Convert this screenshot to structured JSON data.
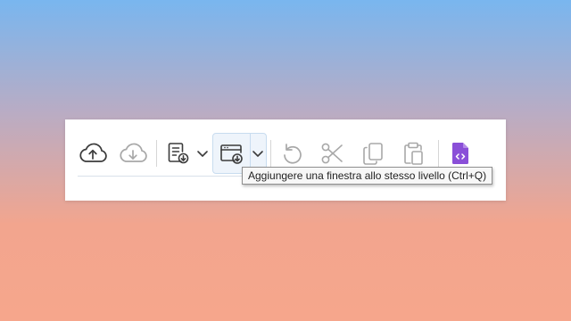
{
  "toolbar": {
    "buttons": [
      {
        "name": "upload-to-cloud",
        "icon": "cloud-upload-icon",
        "enabled": true
      },
      {
        "name": "download-from-cloud",
        "icon": "cloud-download-icon",
        "enabled": false
      },
      {
        "name": "import-document",
        "icon": "document-import-icon",
        "enabled": true
      },
      {
        "name": "add-window-same-level",
        "icon": "window-add-icon",
        "enabled": true,
        "active": true
      },
      {
        "name": "undo",
        "icon": "undo-icon",
        "enabled": false
      },
      {
        "name": "cut",
        "icon": "scissors-icon",
        "enabled": false
      },
      {
        "name": "copy",
        "icon": "copy-icon",
        "enabled": false
      },
      {
        "name": "paste",
        "icon": "clipboard-icon",
        "enabled": false
      },
      {
        "name": "code-file",
        "icon": "code-file-icon",
        "enabled": true
      }
    ]
  },
  "tooltip": {
    "text": "Aggiungere una finestra allo stesso livello (Ctrl+Q)"
  },
  "colors": {
    "icon_enabled": "#3b3b3b",
    "icon_disabled": "#a8a8a8",
    "accent_purple": "#8a4fd8",
    "active_bg": "#eef4fb"
  }
}
